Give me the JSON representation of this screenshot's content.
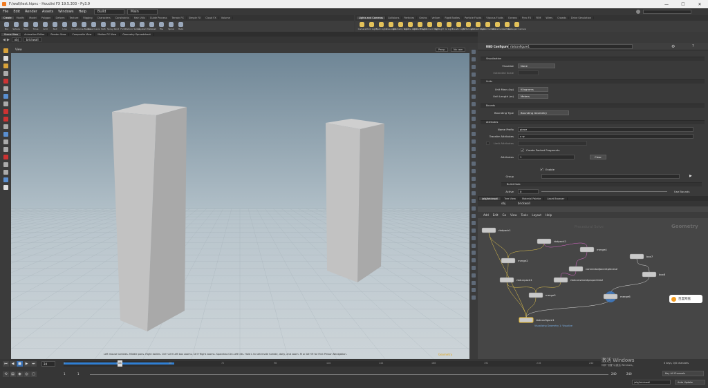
{
  "window": {
    "title": "F:/wall/test.hipnc - Houdini FX 19.5.303 - Py3.9",
    "controls": [
      "—",
      "☐",
      "✕"
    ]
  },
  "menu": {
    "items": [
      "File",
      "Edit",
      "Render",
      "Assets",
      "Windows",
      "Help"
    ],
    "build_label": "Build",
    "main_label": "Main"
  },
  "shelf_tabs_left": [
    "Create",
    "Modify",
    "Model",
    "Polygon",
    "Deform",
    "Texture",
    "Rigging",
    "Characters",
    "Constraints",
    "Hair Utils",
    "Guide Process",
    "Terrain FX",
    "Simple FX",
    "Cloud FX",
    "Volume"
  ],
  "shelf_tabs_right": [
    "Lights and Cameras",
    "Collisions",
    "Particles",
    "Grains",
    "Vellum",
    "Rigid Bodies",
    "Particle Fluids",
    "Viscous Fluids",
    "Oceans",
    "Pyro FX",
    "FEM",
    "Wires",
    "Crowds",
    "Drive Simulation"
  ],
  "shelf_tools_left": [
    "Box",
    "Sphere",
    "Tube",
    "Torus",
    "Grid",
    "Null",
    "Line",
    "Circle",
    "Curve Bezier",
    "Draw Curve",
    "Path",
    "Spray Paint",
    "Font",
    "Platonic Solids",
    "L-System",
    "Metaball",
    "File",
    "Spiral",
    "Helix"
  ],
  "shelf_tools_right": [
    "Camera",
    "Point Light",
    "Spot Light",
    "Area Light",
    "Geometry Light",
    "Volume Light",
    "Distant Light",
    "Environment Light",
    "Sky Light",
    "GI Light",
    "Caustic Light",
    "Portal Light",
    "Ambient Light",
    "Stereo Camera",
    "VR Camera",
    "Switcher",
    "Gamepad Camera"
  ],
  "left_pane_tabs": [
    "Scene View",
    "Animation Editor",
    "Render View",
    "Composite View",
    "Motion FX View",
    "Geometry Spreadsheet"
  ],
  "left_path": {
    "obj": "obj",
    "node": "brickwall"
  },
  "viewport": {
    "tab": "View",
    "persp_label": "Persp",
    "cam_label": "No cam",
    "hint": "Left mouse tumbles. Middle pans. Right dollies. Ctrl+Alt+Left box zooms. Ctrl+Right zooms. Spacebar-Ctrl-Left tilts. Hold L for alternate tumble, dolly, and zoom.    M or Alt+M for First Person Navigation.",
    "status_right": "Geometry"
  },
  "right_pane_tabs": [
    "rbdconfigure1",
    "Take List",
    "Performance Monitor"
  ],
  "right_path": {
    "obj": "obj",
    "node": "brickwall"
  },
  "params": {
    "header_type": "RBD Configure",
    "header_name": "rbdconfigure1",
    "sections": {
      "visualization": "Visualization",
      "units": "Units",
      "bounds": "Bounds",
      "attributes": "Attributes",
      "bullet": "Bullet Data"
    },
    "visualize": {
      "label": "Visualize",
      "value": "None"
    },
    "extended_scale": {
      "label": "Extended Scale",
      "value": ""
    },
    "unit_mass": {
      "label": "Unit Mass (kg)",
      "value": "Kilograms"
    },
    "unit_length": {
      "label": "Unit Length (m)",
      "value": "Meters"
    },
    "bounding_type": {
      "label": "Bounding Type",
      "value": "Bounding Geometry"
    },
    "name_prefix": {
      "label": "Name Prefix",
      "value": "piece"
    },
    "transfer_attrs": {
      "label": "Transfer Attributes",
      "value": "v w"
    },
    "limit_attrs": {
      "label": "Limit Attributes",
      "value": ""
    },
    "create_packed": {
      "label": "Create Packed Fragments"
    },
    "attributes": {
      "label": "Attributes",
      "value": "1",
      "clear": "Clear"
    },
    "enable": {
      "label": "Enable"
    },
    "group": {
      "label": "Group",
      "value": ""
    },
    "active": {
      "label": "Active",
      "value": "0",
      "use_bounds": "Use Bounds"
    }
  },
  "net_pane_tabs": [
    "/obj/brickwall",
    "Tree View",
    "Material Palette",
    "Asset Browser"
  ],
  "net_menu": [
    "Add",
    "Edit",
    "Go",
    "View",
    "Tools",
    "Layout",
    "Help"
  ],
  "net_labels": {
    "title": "Geometry",
    "faded": "Procedural Solve"
  },
  "nodes": [
    {
      "name": "rbdpack1"
    },
    {
      "name": "rbdpack2"
    },
    {
      "name": "merge2"
    },
    {
      "name": "merge4"
    },
    {
      "name": "connectadjacentpieces2"
    },
    {
      "name": "rbdunpack1"
    },
    {
      "name": "rbdconstraintproperties2"
    },
    {
      "name": "merge5"
    },
    {
      "name": "box7"
    },
    {
      "name": "box8"
    },
    {
      "name": "merge6"
    },
    {
      "name": "rbdconfigure1"
    }
  ],
  "node_sublabel": "Visualizing Geometry 1: Visualize",
  "timeline": {
    "current_frame": "24",
    "ticks": [
      "1",
      "24",
      "48",
      "72",
      "96",
      "120",
      "144",
      "168",
      "192",
      "216",
      "240"
    ],
    "start": "1",
    "start2": "1",
    "end1": "240",
    "end2": "240",
    "keys_label": "0 keys, 0/0 channels",
    "key_all": "Key All Channels",
    "path": "/obj/brickwall",
    "auto_update": "Auto Update"
  },
  "cloud_badge": "百度网盘",
  "watermark": {
    "line1": "激活 Windows",
    "line2": "转到\"设置\"以激活 Windows。"
  }
}
